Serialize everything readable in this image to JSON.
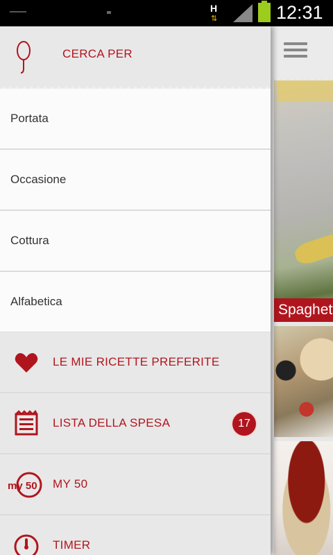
{
  "status_bar": {
    "network": "H",
    "time": "12:31"
  },
  "drawer": {
    "header": {
      "title": "CERCA PER"
    },
    "categories": [
      {
        "label": "Portata"
      },
      {
        "label": "Occasione"
      },
      {
        "label": "Cottura"
      },
      {
        "label": "Alfabetica"
      }
    ],
    "actions": [
      {
        "label": "LE MIE RICETTE PREFERITE",
        "icon": "heart-icon"
      },
      {
        "label": "LISTA DELLA SPESA",
        "icon": "list-icon",
        "badge": "17"
      },
      {
        "label": "MY 50",
        "icon": "my50-icon",
        "icon_text": "my 50"
      },
      {
        "label": "TIMER",
        "icon": "timer-icon"
      }
    ]
  },
  "content": {
    "recipe_caption": "Spaghetti"
  },
  "colors": {
    "accent": "#b0151e",
    "drawer_bg": "#f1f0f0",
    "header_bg": "#e9e8e8"
  }
}
